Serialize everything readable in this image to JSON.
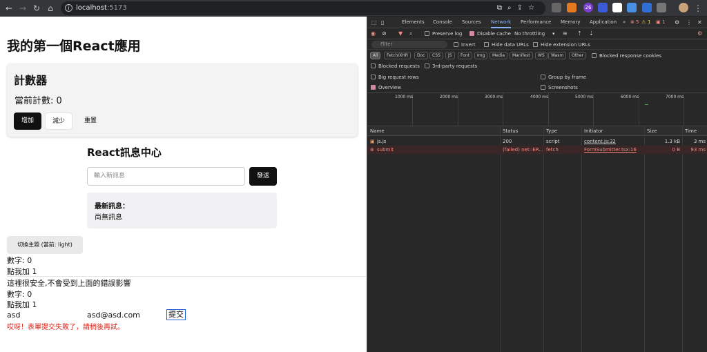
{
  "browser": {
    "url_host": "localhost",
    "url_port": ":5173",
    "badge_count": "26"
  },
  "app": {
    "title": "我的第一個React應用",
    "counter": {
      "heading": "計數器",
      "current_label": "當前計數: 0",
      "increase": "增加",
      "decrease": "減少",
      "reset": "重置"
    },
    "messages": {
      "heading": "React訊息中心",
      "input_placeholder": "輸入新訊息",
      "send": "發送",
      "latest_label": "最新訊息：",
      "latest_value": "尚無訊息"
    },
    "theme_button": "切換主題 (當前: light)",
    "number_1": "數字: 0",
    "click_1": "點我加 1",
    "safe_text": "這裡很安全,不會受到上面的錯誤影響",
    "number_2": "數字: 0",
    "click_2": "點我加 1",
    "form": {
      "name_value": "asd",
      "email_value": "asd@asd.com",
      "submit": "提交",
      "error": "哎呀！表單提交失敗了，請稍後再試。"
    }
  },
  "devtools": {
    "tabs": [
      "Elements",
      "Console",
      "Sources",
      "Network",
      "Performance",
      "Memory",
      "Application"
    ],
    "active_tab": "Network",
    "counts": {
      "errors": "5",
      "warnings": "1",
      "issues": "1"
    },
    "toolbar": {
      "preserve_log": "Preserve log",
      "disable_cache": "Disable cache",
      "throttling": "No throttling"
    },
    "filter": {
      "placeholder": "Filter",
      "invert": "Invert",
      "hide_data_urls": "Hide data URLs",
      "hide_extension_urls": "Hide extension URLs",
      "types": [
        "All",
        "Fetch/XHR",
        "Doc",
        "CSS",
        "JS",
        "Font",
        "Img",
        "Media",
        "Manifest",
        "WS",
        "Wasm",
        "Other"
      ],
      "blocked_response_cookies": "Blocked response cookies",
      "blocked_requests": "Blocked requests",
      "third_party_requests": "3rd-party requests"
    },
    "options": {
      "big_request_rows": "Big request rows",
      "group_by_frame": "Group by frame",
      "overview": "Overview",
      "screenshots": "Screenshots"
    },
    "timeline_ticks": [
      "1000 ms",
      "2000 ms",
      "3000 ms",
      "4000 ms",
      "5000 ms",
      "6000 ms",
      "7000 ms"
    ],
    "columns": [
      "Name",
      "Status",
      "Type",
      "Initiator",
      "Size",
      "Time"
    ],
    "rows": [
      {
        "name": "js.js",
        "status": "200",
        "type": "script",
        "initiator": "content.js:32",
        "size": "1.3 kB",
        "time": "3 ms"
      },
      {
        "name": "submit",
        "status": "(failed) net::ER...",
        "type": "fetch",
        "initiator": "FormSubmitter.tsx:16",
        "size": "0 B",
        "time": "93 ms"
      }
    ]
  }
}
